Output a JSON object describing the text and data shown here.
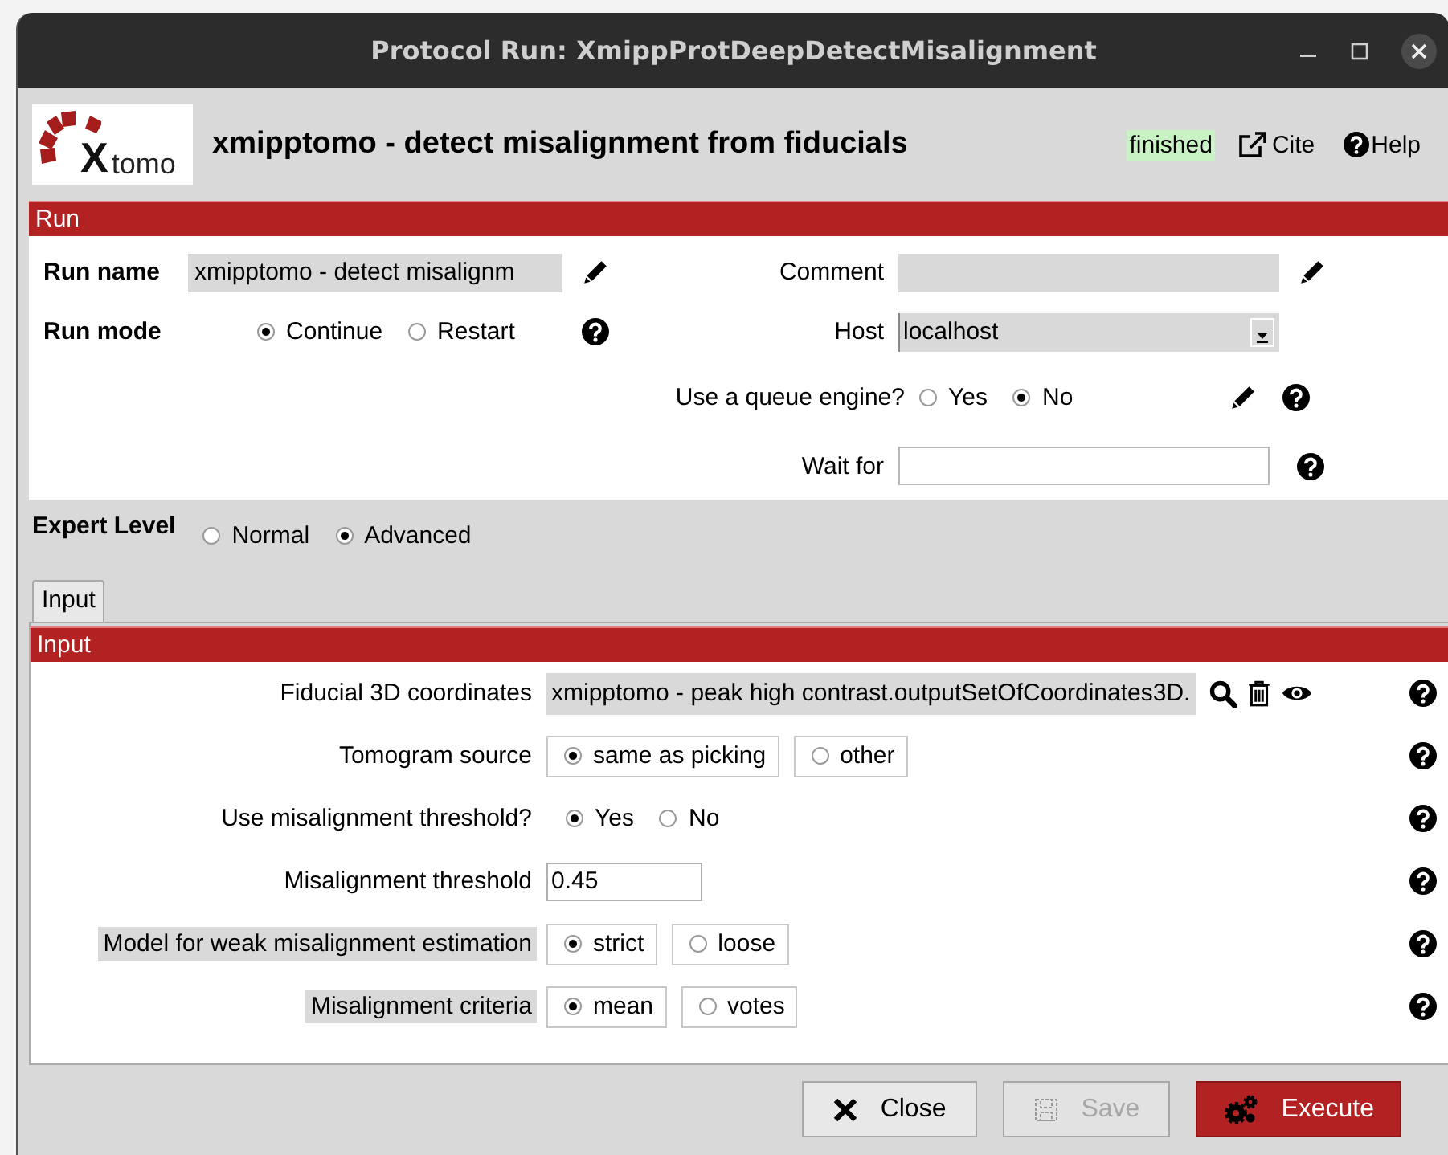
{
  "window": {
    "title": "Protocol Run: XmippProtDeepDetectMisalignment"
  },
  "header": {
    "logo": {
      "mark": "X",
      "text": "tomo"
    },
    "title": "xmipptomo - detect misalignment from fiducials",
    "status": "finished",
    "links": [
      {
        "label": "Cite",
        "kind": "cite"
      },
      {
        "label": "Help",
        "kind": "help"
      }
    ]
  },
  "run_section": {
    "title": "Run",
    "run_name": {
      "label": "Run name",
      "value": "xmipptomo - detect misalignm"
    },
    "comment": {
      "label": "Comment"
    },
    "run_mode": {
      "label": "Run mode",
      "options": [
        {
          "label": "Continue",
          "selected": true
        },
        {
          "label": "Restart",
          "selected": false
        }
      ]
    },
    "host": {
      "label": "Host",
      "value": "localhost"
    },
    "queue": {
      "label": "Use a queue engine?",
      "options": [
        {
          "label": "Yes",
          "selected": false
        },
        {
          "label": "No",
          "selected": true
        }
      ]
    },
    "wait_for": {
      "label": "Wait for"
    }
  },
  "expert_level": {
    "label": "Expert Level",
    "options": [
      {
        "label": "Normal",
        "selected": false
      },
      {
        "label": "Advanced",
        "selected": true
      }
    ]
  },
  "tabs": [
    {
      "label": "Input",
      "selected": true
    }
  ],
  "input_section": {
    "title": "Input",
    "params": [
      {
        "kind": "pointer",
        "label": "Fiducial 3D coordinates",
        "highlighted": false,
        "value": "xmipptomo - peak high contrast.outputSetOfCoordinates3D."
      },
      {
        "kind": "boxed_radio",
        "label": "Tomogram source",
        "highlighted": false,
        "options": [
          {
            "label": "same as picking",
            "selected": true
          },
          {
            "label": "other",
            "selected": false
          }
        ]
      },
      {
        "kind": "radio",
        "label": "Use misalignment threshold?",
        "highlighted": false,
        "options": [
          {
            "label": "Yes",
            "selected": true
          },
          {
            "label": "No",
            "selected": false
          }
        ]
      },
      {
        "kind": "text",
        "label": "Misalignment threshold",
        "highlighted": false,
        "value": "0.45"
      },
      {
        "kind": "boxed_radio",
        "label": "Model for weak misalignment estimation",
        "highlighted": true,
        "options": [
          {
            "label": "strict",
            "selected": true
          },
          {
            "label": "loose",
            "selected": false
          }
        ]
      },
      {
        "kind": "boxed_radio",
        "label": "Misalignment criteria",
        "highlighted": true,
        "options": [
          {
            "label": "mean",
            "selected": true
          },
          {
            "label": "votes",
            "selected": false
          }
        ]
      }
    ]
  },
  "buttons": [
    {
      "label": "Close",
      "kind": "close",
      "disabled": false
    },
    {
      "label": "Save",
      "kind": "save",
      "disabled": true
    },
    {
      "label": "Execute",
      "kind": "execute",
      "disabled": false
    }
  ]
}
